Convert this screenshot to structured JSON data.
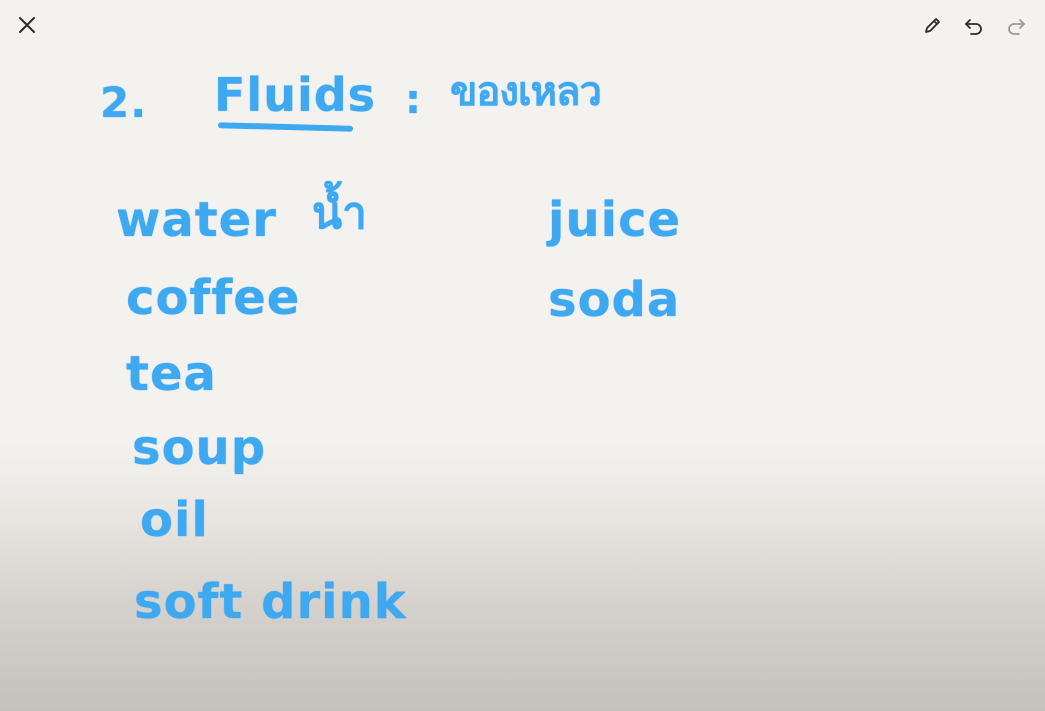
{
  "toolbar": {
    "close_icon": "close-icon",
    "pen_icon": "pencil-icon",
    "undo_icon": "undo-icon",
    "redo_icon": "redo-icon"
  },
  "colors": {
    "ink": "#3ea8f0",
    "background": "#f4f2ef",
    "icon": "#2b2b2b",
    "icon_disabled": "#9a9a9a"
  },
  "board": {
    "heading": {
      "number": "2.",
      "word": "Fluids",
      "colon": ":",
      "thai": "ของเหลว"
    },
    "left_column": {
      "water": "water",
      "water_thai": "น้ำ",
      "coffee": "coffee",
      "tea": "tea",
      "soup": "soup",
      "oil": "oil",
      "soft_drink": "soft drink"
    },
    "right_column": {
      "juice": "juice",
      "soda": "soda"
    }
  }
}
